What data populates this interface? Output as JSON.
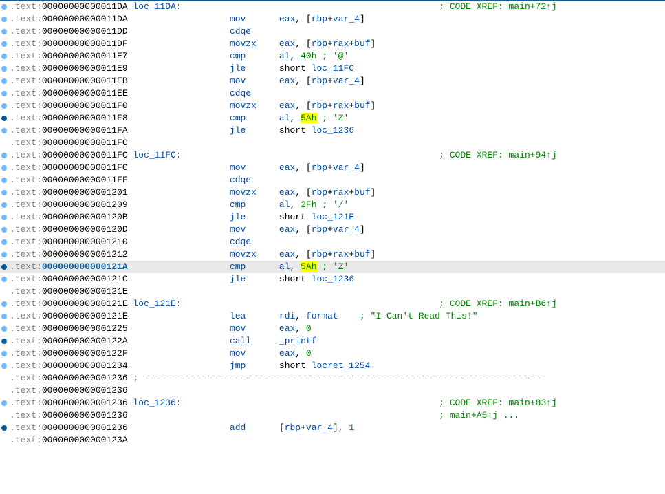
{
  "lines": [
    {
      "dot": "light",
      "addr": "00000000000011DA",
      "label": "loc_11DA:",
      "mnemonic": "",
      "operands": [],
      "xref": "; CODE XREF: main+72↑j"
    },
    {
      "dot": "light",
      "addr": "00000000000011DA",
      "mnemonic": "mov",
      "operands": [
        [
          "reg",
          "eax"
        ],
        [
          "text",
          ", ["
        ],
        [
          "reg",
          "rbp"
        ],
        [
          "text",
          "+"
        ],
        [
          "ident",
          "var_4"
        ],
        [
          "text",
          "]"
        ]
      ]
    },
    {
      "dot": "light",
      "addr": "00000000000011DD",
      "mnemonic": "cdqe",
      "operands": []
    },
    {
      "dot": "light",
      "addr": "00000000000011DF",
      "mnemonic": "movzx",
      "operands": [
        [
          "reg",
          "eax"
        ],
        [
          "text",
          ", ["
        ],
        [
          "reg",
          "rbp"
        ],
        [
          "text",
          "+"
        ],
        [
          "reg",
          "rax"
        ],
        [
          "text",
          "+"
        ],
        [
          "ident",
          "buf"
        ],
        [
          "text",
          "]"
        ]
      ]
    },
    {
      "dot": "light",
      "addr": "00000000000011E7",
      "mnemonic": "cmp",
      "operands": [
        [
          "reg",
          "al"
        ],
        [
          "text",
          ", "
        ],
        [
          "const",
          "40h"
        ],
        [
          "text",
          " "
        ],
        [
          "comment",
          "; '@'"
        ]
      ]
    },
    {
      "dot": "light",
      "addr": "00000000000011E9",
      "mnemonic": "jle",
      "operands": [
        [
          "text",
          "short "
        ],
        [
          "ident",
          "loc_11FC"
        ]
      ]
    },
    {
      "dot": "light",
      "addr": "00000000000011EB",
      "mnemonic": "mov",
      "operands": [
        [
          "reg",
          "eax"
        ],
        [
          "text",
          ", ["
        ],
        [
          "reg",
          "rbp"
        ],
        [
          "text",
          "+"
        ],
        [
          "ident",
          "var_4"
        ],
        [
          "text",
          "]"
        ]
      ]
    },
    {
      "dot": "light",
      "addr": "00000000000011EE",
      "mnemonic": "cdqe",
      "operands": []
    },
    {
      "dot": "light",
      "addr": "00000000000011F0",
      "mnemonic": "movzx",
      "operands": [
        [
          "reg",
          "eax"
        ],
        [
          "text",
          ", ["
        ],
        [
          "reg",
          "rbp"
        ],
        [
          "text",
          "+"
        ],
        [
          "reg",
          "rax"
        ],
        [
          "text",
          "+"
        ],
        [
          "ident",
          "buf"
        ],
        [
          "text",
          "]"
        ]
      ]
    },
    {
      "dot": "dark",
      "addr": "00000000000011F8",
      "mnemonic": "cmp",
      "operands": [
        [
          "reg",
          "al"
        ],
        [
          "text",
          ", "
        ],
        [
          "hl",
          "5Ah"
        ],
        [
          "text",
          " "
        ],
        [
          "comment",
          "; 'Z'"
        ]
      ]
    },
    {
      "dot": "light",
      "addr": "00000000000011FA",
      "mnemonic": "jle",
      "operands": [
        [
          "text",
          "short "
        ],
        [
          "ident",
          "loc_1236"
        ]
      ]
    },
    {
      "addr": "00000000000011FC",
      "mnemonic": "",
      "operands": []
    },
    {
      "dot": "light",
      "addr": "00000000000011FC",
      "label": "loc_11FC:",
      "mnemonic": "",
      "operands": [],
      "xref": "; CODE XREF: main+94↑j"
    },
    {
      "dot": "light",
      "addr": "00000000000011FC",
      "mnemonic": "mov",
      "operands": [
        [
          "reg",
          "eax"
        ],
        [
          "text",
          ", ["
        ],
        [
          "reg",
          "rbp"
        ],
        [
          "text",
          "+"
        ],
        [
          "ident",
          "var_4"
        ],
        [
          "text",
          "]"
        ]
      ]
    },
    {
      "dot": "light",
      "addr": "00000000000011FF",
      "mnemonic": "cdqe",
      "operands": []
    },
    {
      "dot": "light",
      "addr": "0000000000001201",
      "mnemonic": "movzx",
      "operands": [
        [
          "reg",
          "eax"
        ],
        [
          "text",
          ", ["
        ],
        [
          "reg",
          "rbp"
        ],
        [
          "text",
          "+"
        ],
        [
          "reg",
          "rax"
        ],
        [
          "text",
          "+"
        ],
        [
          "ident",
          "buf"
        ],
        [
          "text",
          "]"
        ]
      ]
    },
    {
      "dot": "light",
      "addr": "0000000000001209",
      "mnemonic": "cmp",
      "operands": [
        [
          "reg",
          "al"
        ],
        [
          "text",
          ", "
        ],
        [
          "const",
          "2Fh"
        ],
        [
          "text",
          " "
        ],
        [
          "comment",
          "; '/'"
        ]
      ]
    },
    {
      "dot": "light",
      "addr": "000000000000120B",
      "mnemonic": "jle",
      "operands": [
        [
          "text",
          "short "
        ],
        [
          "ident",
          "loc_121E"
        ]
      ]
    },
    {
      "dot": "light",
      "addr": "000000000000120D",
      "mnemonic": "mov",
      "operands": [
        [
          "reg",
          "eax"
        ],
        [
          "text",
          ", ["
        ],
        [
          "reg",
          "rbp"
        ],
        [
          "text",
          "+"
        ],
        [
          "ident",
          "var_4"
        ],
        [
          "text",
          "]"
        ]
      ]
    },
    {
      "dot": "light",
      "addr": "0000000000001210",
      "mnemonic": "cdqe",
      "operands": []
    },
    {
      "dot": "light",
      "addr": "0000000000001212",
      "mnemonic": "movzx",
      "operands": [
        [
          "reg",
          "eax"
        ],
        [
          "text",
          ", ["
        ],
        [
          "reg",
          "rbp"
        ],
        [
          "text",
          "+"
        ],
        [
          "reg",
          "rax"
        ],
        [
          "text",
          "+"
        ],
        [
          "ident",
          "buf"
        ],
        [
          "text",
          "]"
        ]
      ]
    },
    {
      "dot": "dark",
      "addr": "000000000000121A",
      "mnemonic": "cmp",
      "operands": [
        [
          "reg",
          "al"
        ],
        [
          "text",
          ", "
        ],
        [
          "hl",
          "5Ah"
        ],
        [
          "text",
          " "
        ],
        [
          "comment",
          "; 'Z'"
        ]
      ],
      "selected": true
    },
    {
      "dot": "light",
      "addr": "000000000000121C",
      "mnemonic": "jle",
      "operands": [
        [
          "text",
          "short "
        ],
        [
          "ident",
          "loc_1236"
        ]
      ]
    },
    {
      "addr": "000000000000121E",
      "mnemonic": "",
      "operands": []
    },
    {
      "dot": "light",
      "addr": "000000000000121E",
      "label": "loc_121E:",
      "mnemonic": "",
      "operands": [],
      "xref": "; CODE XREF: main+B6↑j"
    },
    {
      "dot": "light",
      "addr": "000000000000121E",
      "mnemonic": "lea",
      "operands": [
        [
          "reg",
          "rdi"
        ],
        [
          "text",
          ", "
        ],
        [
          "ident",
          "format"
        ],
        [
          "text",
          "    "
        ],
        [
          "comment",
          "; \"I Can't Read This!\""
        ]
      ]
    },
    {
      "dot": "light",
      "addr": "0000000000001225",
      "mnemonic": "mov",
      "operands": [
        [
          "reg",
          "eax"
        ],
        [
          "text",
          ", "
        ],
        [
          "const",
          "0"
        ]
      ]
    },
    {
      "dot": "dark",
      "addr": "000000000000122A",
      "mnemonic": "call",
      "operands": [
        [
          "ident",
          "_printf"
        ]
      ]
    },
    {
      "dot": "light",
      "addr": "000000000000122F",
      "mnemonic": "mov",
      "operands": [
        [
          "reg",
          "eax"
        ],
        [
          "text",
          ", "
        ],
        [
          "const",
          "0"
        ]
      ]
    },
    {
      "dot": "light",
      "addr": "0000000000001234",
      "mnemonic": "jmp",
      "operands": [
        [
          "text",
          "short "
        ],
        [
          "ident",
          "locret_1254"
        ]
      ]
    },
    {
      "addr": "0000000000001236",
      "dashline": true
    },
    {
      "addr": "0000000000001236",
      "mnemonic": "",
      "operands": []
    },
    {
      "dot": "light",
      "addr": "0000000000001236",
      "label": "loc_1236:",
      "mnemonic": "",
      "operands": [],
      "xref": "; CODE XREF: main+83↑j"
    },
    {
      "addr": "0000000000001236",
      "mnemonic": "",
      "operands": [],
      "xref": "; main+A5↑j ..."
    },
    {
      "dot": "dark",
      "addr": "0000000000001236",
      "mnemonic": "add",
      "operands": [
        [
          "text",
          "["
        ],
        [
          "reg",
          "rbp"
        ],
        [
          "text",
          "+"
        ],
        [
          "ident",
          "var_4"
        ],
        [
          "text",
          "], "
        ],
        [
          "const",
          "1"
        ]
      ]
    },
    {
      "addr": "000000000000123A",
      "mnemonic": "",
      "operands": []
    }
  ],
  "section_prefix": ".text:",
  "mnemonic_col_pad": "                  ",
  "xref_col": 57,
  "dash_fill": "---------------------------------------------------------------------------"
}
